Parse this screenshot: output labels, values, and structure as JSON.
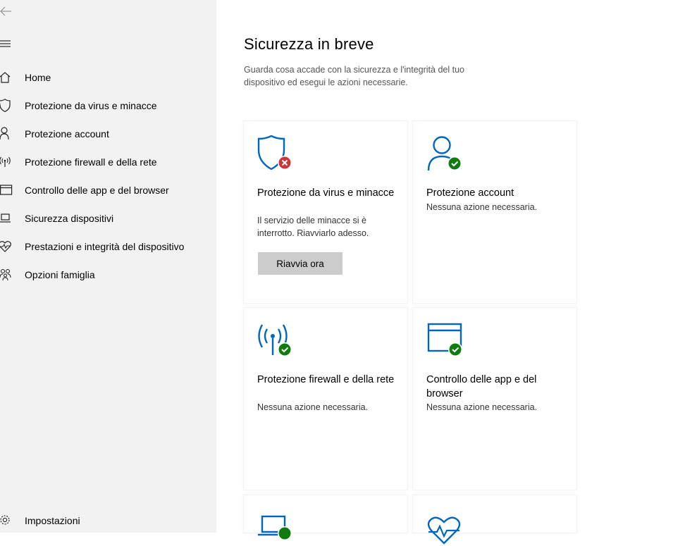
{
  "sidebar": {
    "back_icon": "back-arrow-icon",
    "menu_icon": "hamburger-icon",
    "items": [
      {
        "label": "Home",
        "icon": "home-icon"
      },
      {
        "label": "Protezione da virus e minacce",
        "icon": "shield-icon"
      },
      {
        "label": "Protezione account",
        "icon": "person-icon"
      },
      {
        "label": "Protezione firewall e della rete",
        "icon": "wireless-icon"
      },
      {
        "label": "Controllo delle app e del browser",
        "icon": "browser-window-icon"
      },
      {
        "label": "Sicurezza dispositivi",
        "icon": "laptop-icon"
      },
      {
        "label": "Prestazioni e integrità del dispositivo",
        "icon": "heart-pulse-icon"
      },
      {
        "label": "Opzioni famiglia",
        "icon": "family-icon"
      }
    ],
    "settings": {
      "label": "Impostazioni",
      "icon": "gear-icon"
    }
  },
  "main": {
    "title": "Sicurezza in breve",
    "description": "Guarda cosa accade con la sicurezza e l'integrità del tuo dispositivo ed esegui le azioni necessarie.",
    "tiles": [
      {
        "title": "Protezione da virus e minacce",
        "status": "Il servizio delle minacce si è interrotto. Riavviarlo adesso.",
        "button": "Riavvia ora",
        "state": "error"
      },
      {
        "title": "Protezione account",
        "status": "Nessuna azione necessaria.",
        "state": "ok"
      },
      {
        "title": "Protezione firewall e della rete",
        "status": "Nessuna azione necessaria.",
        "state": "ok"
      },
      {
        "title": "Controllo delle app e del browser",
        "status": "Nessuna azione necessaria.",
        "state": "ok"
      }
    ]
  },
  "colors": {
    "accent": "#0067c0",
    "ok": "#107c10",
    "error": "#d13438",
    "sidebar_bg": "#f2f2f2",
    "button_bg": "#cccccc"
  }
}
